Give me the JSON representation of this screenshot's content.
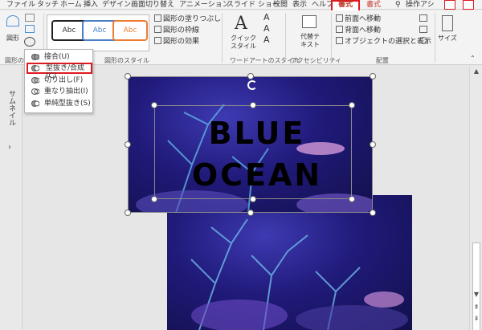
{
  "tabs": {
    "file": "ファイル",
    "touch": "タッチ",
    "home": "ホーム",
    "insert": "挿入",
    "design": "デザイン",
    "transitions": "画面切り替え",
    "animations": "アニメーション",
    "slideshow": "スライド ショー",
    "review": "校閲",
    "view": "表示",
    "help": "ヘルプ",
    "format_active": "書式",
    "format2": "書式",
    "tell_me": "操作アシ"
  },
  "ribbon": {
    "insert_shape_label": "図形",
    "insert_shape_group": "図形の",
    "abc_styles": [
      "Abc",
      "Abc",
      "Abc"
    ],
    "shape_fill": "図形の塗りつぶし",
    "shape_outline": "図形の枠線",
    "shape_effects": "図形の効果",
    "shape_styles_group": "図形のスタイル",
    "quick_styles": "クイック\nスタイル",
    "wordart_group": "ワードアートのスタイル",
    "alt_text": "代替テ\nキスト",
    "accessibility_group": "アクセシビリティ",
    "bring_forward": "前面へ移動",
    "send_backward": "背面へ移動",
    "selection_pane": "オブジェクトの選択と表示",
    "arrange_group": "配置",
    "size": "サイズ"
  },
  "merge_menu": {
    "items": [
      {
        "label": "接合(U)",
        "icon": "union-icon"
      },
      {
        "label": "型抜き/合成(C)",
        "icon": "combine-icon",
        "highlighted": true
      },
      {
        "label": "切り出し(F)",
        "icon": "fragment-icon"
      },
      {
        "label": "重なり抽出(I)",
        "icon": "intersect-icon"
      },
      {
        "label": "単純型抜き(S)",
        "icon": "subtract-icon"
      }
    ]
  },
  "left_pane": {
    "label": "サムネイル"
  },
  "slide": {
    "text_line1": "BLUE",
    "text_line2": "OCEAN"
  },
  "colors": {
    "accent_red": "#e0191f",
    "ribbon_bg": "#f3f3f3",
    "ocean_blue": "#2a2390"
  }
}
